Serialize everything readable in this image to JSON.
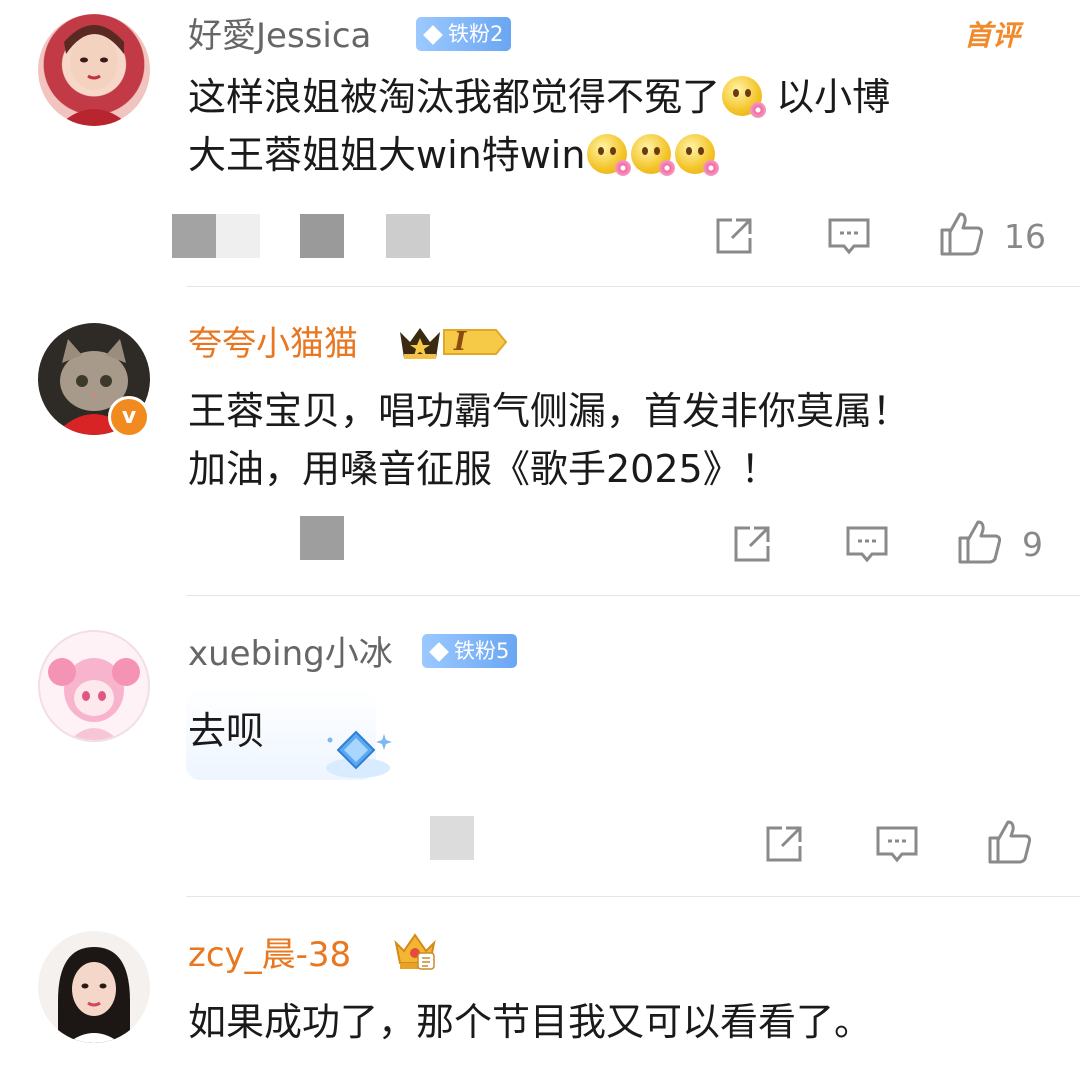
{
  "comments": [
    {
      "username": "好愛Jessica",
      "badge": "铁粉2",
      "top_tag": "首评",
      "text_line1": "这样浪姐被淘汰我都觉得不冤了",
      "text_line1b": "以小博",
      "text_line2": "大王蓉姐姐大win特win",
      "like_count": "16"
    },
    {
      "username": "夸夸小猫猫",
      "vip_level": "I",
      "text_line1": "王蓉宝贝，唱功霸气侧漏，首发非你莫属！",
      "text_line2": "加油，用嗓音征服《歌手2025》！",
      "like_count": "9"
    },
    {
      "username": "xuebing小冰",
      "badge": "铁粉5",
      "text_line1": "去呗",
      "like_count": ""
    },
    {
      "username": "zcy_晨-38",
      "text_line1": "如果成功了，那个节目我又可以看看了。"
    }
  ],
  "colors": {
    "accent_orange": "#e8771f",
    "badge_blue": "#6aa6f3",
    "icon_gray": "#8a8a8a"
  }
}
